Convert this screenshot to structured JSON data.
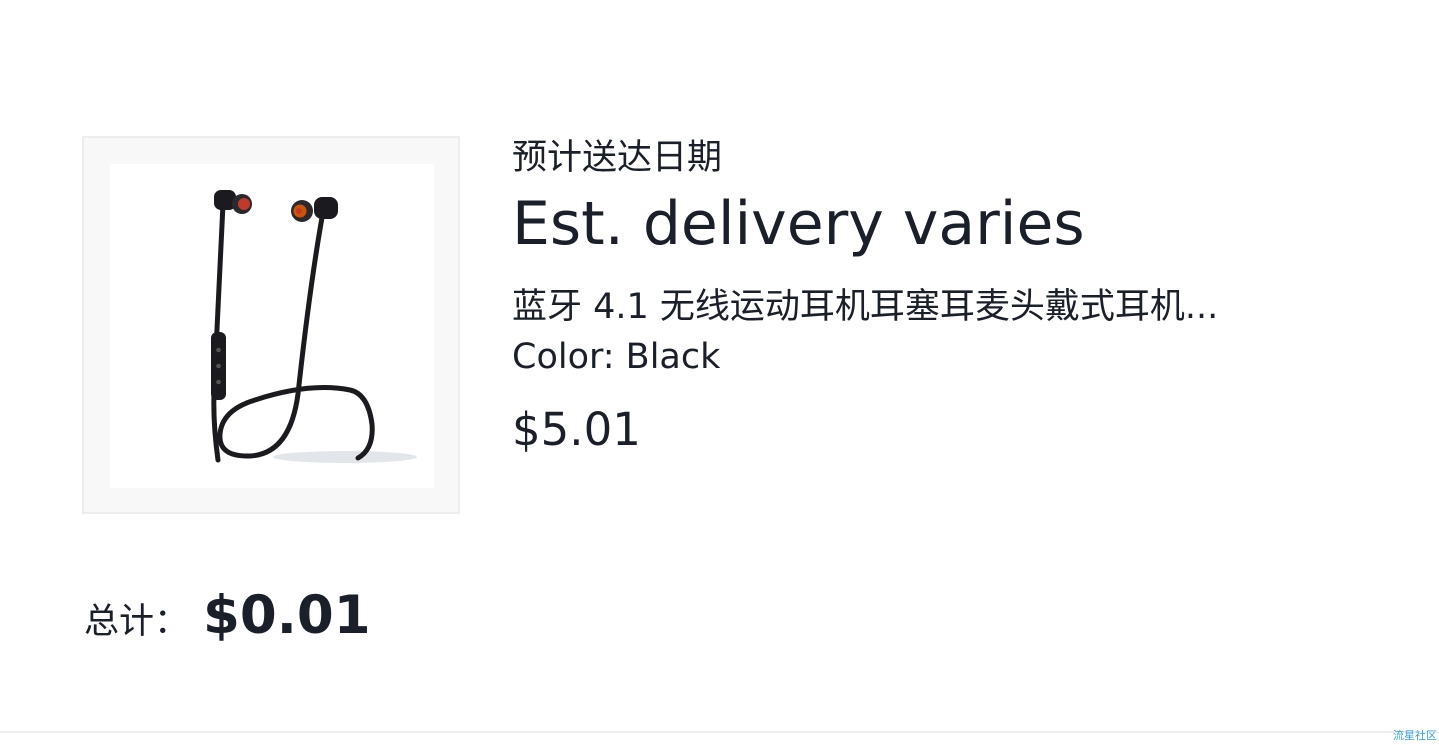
{
  "delivery": {
    "label": "预计送达日期",
    "value": "Est. delivery varies"
  },
  "item": {
    "image_icon": "earphones-product-image",
    "title": "蓝牙 4.1 无线运动耳机耳塞耳麦头戴式耳机...",
    "variant": "Color: Black",
    "price": "$5.01"
  },
  "summary": {
    "total_label": "总计：",
    "total_value": "$0.01"
  },
  "watermark": "流星社区",
  "colors": {
    "text": "#1a1f29",
    "border": "#ededed",
    "watermark": "#3aa0e0"
  }
}
